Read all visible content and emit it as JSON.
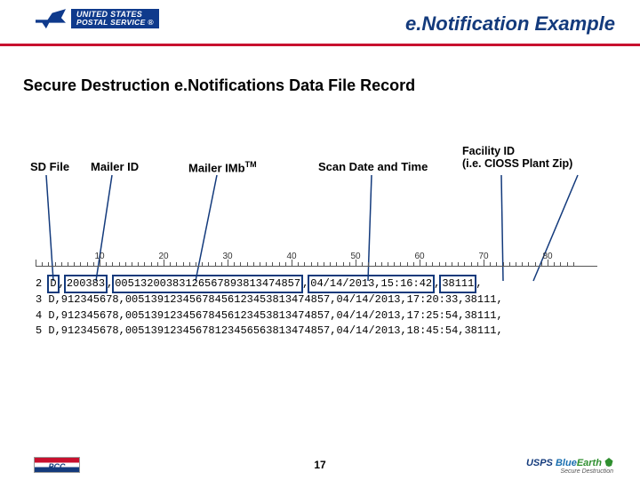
{
  "header": {
    "logo_line1": "UNITED STATES",
    "logo_line2": "POSTAL SERVICE ®",
    "title": "e.Notification Example"
  },
  "subtitle": "Secure Destruction e.Notifications Data File Record",
  "callouts": {
    "sd_file": "SD File",
    "mailer_id": "Mailer ID",
    "mailer_imb": "Mailer IMb",
    "tm": "TM",
    "scan": "Scan Date and Time",
    "facility_l1": "Facility ID",
    "facility_l2": "(i.e. CIOSS Plant Zip)"
  },
  "ruler_ticks": [
    10,
    20,
    30,
    40,
    50,
    60,
    70,
    80
  ],
  "records": [
    {
      "n": "2",
      "type": "D",
      "mailer": "200383",
      "imb": "00513200383126567893813474857",
      "date": "04/14/2013",
      "time": "15:16:42",
      "zip": "38111"
    },
    {
      "n": "3",
      "type": "D",
      "mailer": "912345678",
      "imb": "00513912345678456123453813474857",
      "date": "04/14/2013",
      "time": "17:20:33",
      "zip": "38111"
    },
    {
      "n": "4",
      "type": "D",
      "mailer": "912345678",
      "imb": "00513912345678456123453813474857",
      "date": "04/14/2013",
      "time": "17:25:54",
      "zip": "38111"
    },
    {
      "n": "5",
      "type": "D",
      "mailer": "912345678",
      "imb": "00513912345678123456563813474857",
      "date": "04/14/2013",
      "time": "18:45:54",
      "zip": "38111"
    }
  ],
  "footer": {
    "pcc": "PCC",
    "page": "17",
    "usps": "USPS",
    "blue": "Blue",
    "earth": "Earth",
    "tagline": "Secure Destruction"
  }
}
